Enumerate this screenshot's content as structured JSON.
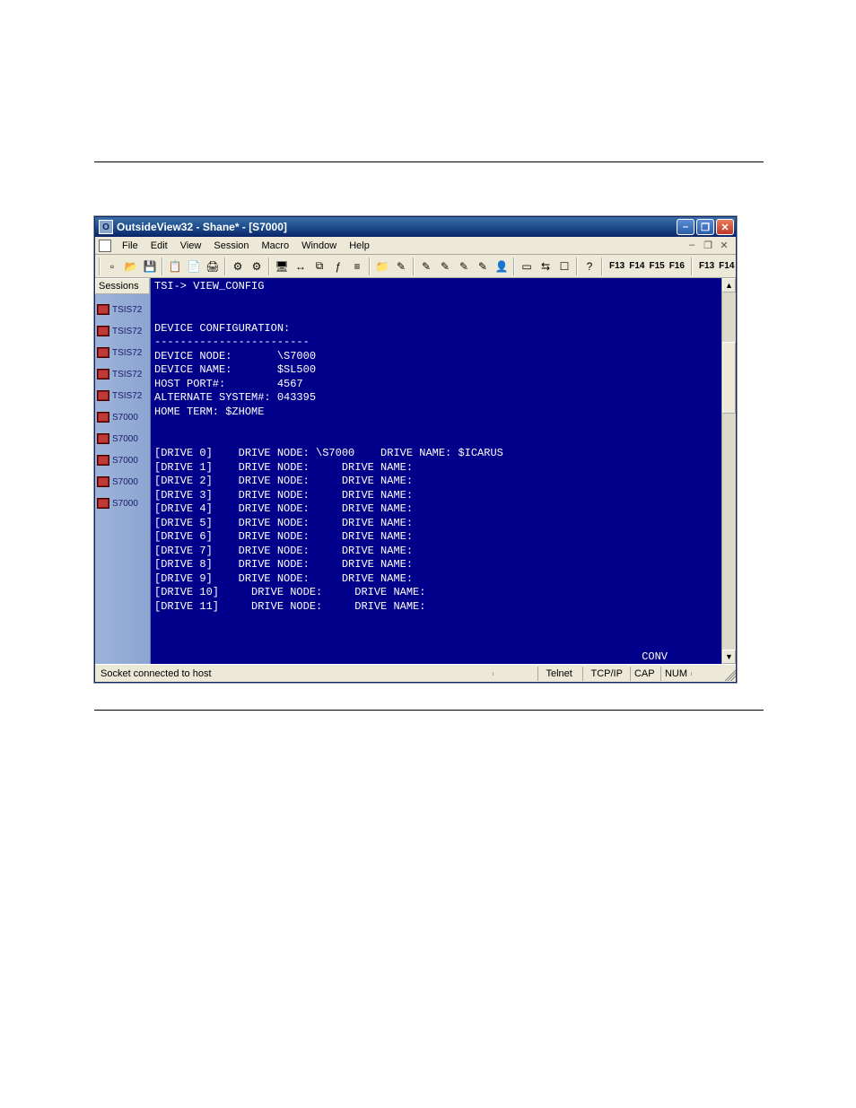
{
  "titlebar": {
    "app": "OutsideView32",
    "doc": "Shane*",
    "session": "[S7000]"
  },
  "menus": [
    "File",
    "Edit",
    "View",
    "Session",
    "Macro",
    "Window",
    "Help"
  ],
  "toolbar_icons": [
    "new",
    "open",
    "save",
    "copy",
    "paste",
    "print",
    "cfg1",
    "cfg2",
    "screen",
    "conn",
    "chain",
    "fn",
    "bars",
    "folder",
    "i1",
    "i2",
    "i3",
    "i4",
    "i5",
    "user",
    "doc",
    "net",
    "box",
    "help"
  ],
  "fkeys_left": [
    "F13",
    "F14",
    "F15",
    "F16"
  ],
  "fkeys_right": [
    "F13",
    "F14"
  ],
  "sidebar": {
    "header": "Sessions",
    "items": [
      "TSIS72",
      "TSIS72",
      "TSIS72",
      "TSIS72",
      "TSIS72",
      "S7000",
      "S7000",
      "S7000",
      "S7000",
      "S7000"
    ]
  },
  "terminal": {
    "prompt_line": "TSI-> VIEW_CONFIG",
    "blank": "",
    "section_title": "DEVICE CONFIGURATION:",
    "separator_line": "------------------------",
    "lines_config": [
      "DEVICE NODE:       \\S7000",
      "DEVICE NAME:       $SL500",
      "HOST PORT#:        4567",
      "ALTERNATE SYSTEM#: 043395",
      "HOME TERM: $ZHOME"
    ],
    "drive_header": "[DRIVE 0]    DRIVE NODE: \\S7000    DRIVE NAME: $ICARUS",
    "drives": [
      "[DRIVE 1]    DRIVE NODE:     DRIVE NAME:",
      "[DRIVE 2]    DRIVE NODE:     DRIVE NAME:",
      "[DRIVE 3]    DRIVE NODE:     DRIVE NAME:",
      "[DRIVE 4]    DRIVE NODE:     DRIVE NAME:",
      "[DRIVE 5]    DRIVE NODE:     DRIVE NAME:",
      "[DRIVE 6]    DRIVE NODE:     DRIVE NAME:",
      "[DRIVE 7]    DRIVE NODE:     DRIVE NAME:",
      "[DRIVE 8]    DRIVE NODE:     DRIVE NAME:",
      "[DRIVE 9]    DRIVE NODE:     DRIVE NAME:",
      "[DRIVE 10]     DRIVE NODE:     DRIVE NAME:",
      "[DRIVE 11]     DRIVE NODE:     DRIVE NAME:"
    ],
    "conv": "CONV"
  },
  "statusbar": {
    "msg": "Socket connected to host",
    "conn": "Telnet",
    "proto": "TCP/IP",
    "cap": "CAP",
    "num": "NUM"
  },
  "icon_glyphs": {
    "new": "▫",
    "open": "📂",
    "save": "💾",
    "copy": "📋",
    "paste": "📄",
    "print": "🖨",
    "cfg1": "⚙",
    "cfg2": "⚙",
    "screen": "🖥",
    "conn": "↔",
    "chain": "⧉",
    "fn": "ƒ",
    "bars": "≡",
    "folder": "📁",
    "i1": "✎",
    "i2": "✎",
    "i3": "✎",
    "i4": "✎",
    "i5": "✎",
    "user": "👤",
    "doc": "▭",
    "net": "⇆",
    "box": "☐",
    "help": "?"
  }
}
